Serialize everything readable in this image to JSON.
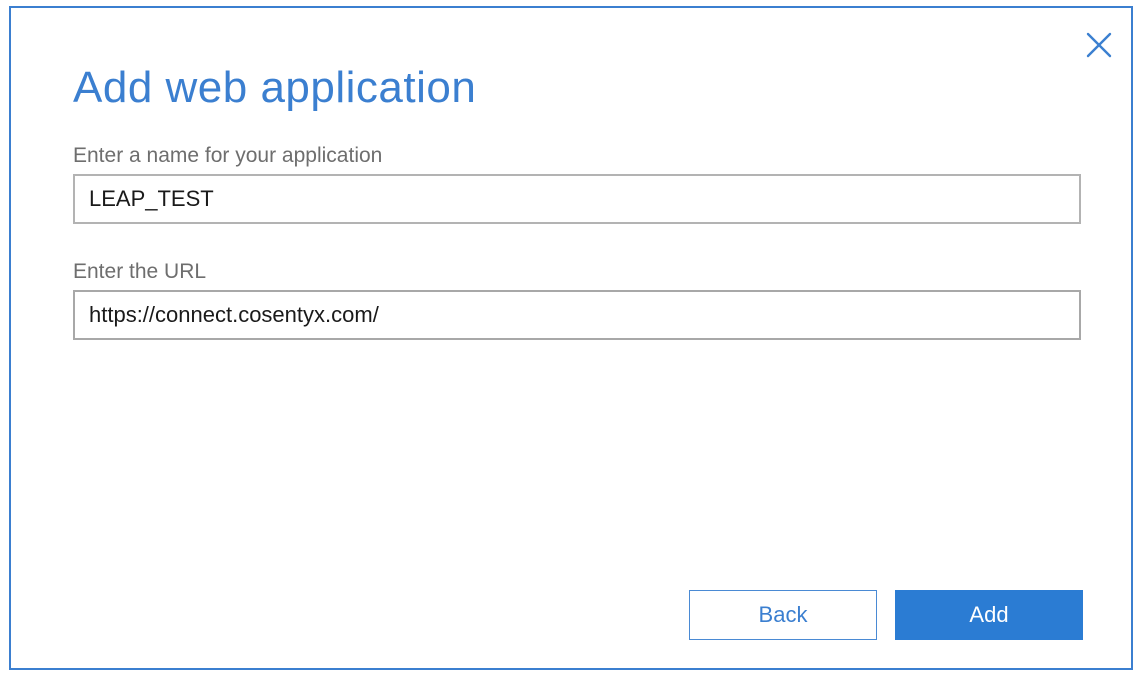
{
  "dialog": {
    "title": "Add web application",
    "name_label": "Enter a name for your application",
    "name_value": "LEAP_TEST",
    "url_label": "Enter the URL",
    "url_value": "https://connect.cosentyx.com/",
    "back_label": "Back",
    "add_label": "Add",
    "close_icon": "close-icon"
  },
  "colors": {
    "accent": "#3b7fd0",
    "primary_button": "#2b7cd3",
    "label_text": "#6e6e6e",
    "input_border": "#b3b3b3"
  }
}
